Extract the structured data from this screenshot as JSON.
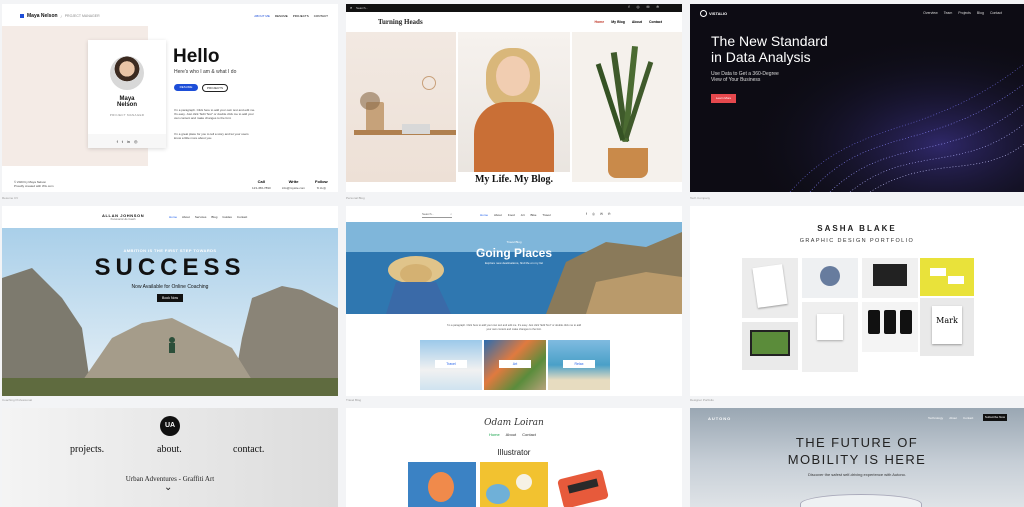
{
  "card1": {
    "brand": "Maya Nelson",
    "brand_sub": "PROJECT MANAGER",
    "nav": [
      "ABOUT ME",
      "RESUME",
      "PROJECTS",
      "CONTACT"
    ],
    "card_name": "Maya\nNelson",
    "card_role": "PROJECT MANAGER",
    "hello": "Hello",
    "tagline": "Here's who I am & what I do",
    "btn_resume": "RESUME",
    "btn_projects": "PROJECTS",
    "para1": "I'm a paragraph. Click here to add your own text and edit me. It's easy. Just click \"Edit Text\" or double click me to add your own content and make changes to the font.",
    "para2": "I'm a great place for you to tell a story and let your users know a little more about you.",
    "footer_copy": "© 2023 by Maya Nelson",
    "footer_copy2": "Proudly created with Wix.com",
    "call_label": "Call",
    "call_value": "123-456-7890",
    "write_label": "Write",
    "write_value": "info@mysite.com",
    "follow_label": "Follow",
    "caption": "Resume CV",
    "colors": {
      "accent": "#1d4ed8",
      "panel": "#f4ebe6"
    }
  },
  "card2": {
    "search": "Search...",
    "title": "Turning Heads",
    "nav": [
      "Home",
      "My Blog",
      "About",
      "Contact"
    ],
    "banner": "My Life. My Blog.",
    "caption": "Personal Blog"
  },
  "card3": {
    "logo": "VISTALIO",
    "nav": [
      "Overview",
      "Team",
      "Projects",
      "Blog",
      "Contact"
    ],
    "headline": "The New Standard\nin Data Analysis",
    "sub": "Use Data to Get a 360-Degree\nView of Your Business",
    "cta": "Learn More",
    "caption": "Tech Company",
    "colors": {
      "cta": "#e5484d"
    }
  },
  "card4": {
    "brand": "ALLAN JOHNSON",
    "brand_sub": "Personal & Life Coach",
    "nav": [
      "Home",
      "About",
      "Services",
      "Blog",
      "Guides",
      "Contact"
    ],
    "kicker": "AMBITION IS THE FIRST STEP TOWARDS",
    "headline": "SUCCESS",
    "sub": "Now Available for Online Coaching",
    "cta": "Book Now",
    "caption": "Coaching Professional"
  },
  "card5": {
    "search": "Search...",
    "nav": [
      "Home",
      "About",
      "Food",
      "Art",
      "Bike",
      "Travel"
    ],
    "kicker": "Travel Blog",
    "headline": "Going Places",
    "sub": "Explore new destinations, find life on my list",
    "para": "I'm a paragraph. Click here to add your own text and edit me. It's easy. Just click \"Edit Text\" or double click me to add your own content and make changes to the font.",
    "thumbs": [
      "Travel",
      "Art",
      "Relax"
    ],
    "caption": "Travel Blog"
  },
  "card6": {
    "name": "SASHA BLAKE",
    "subtitle": "GRAPHIC DESIGN PORTFOLIO",
    "caption": "Designer Portfolio"
  },
  "card7": {
    "logo": "UA",
    "links": [
      "projects.",
      "about.",
      "contact."
    ],
    "title": "Urban Adventures - Graffiti Art",
    "chevron": "⌄"
  },
  "card8": {
    "logo": "Odam Loiran",
    "nav": [
      "Home",
      "About",
      "Contact"
    ],
    "section": "Illustrator"
  },
  "card9": {
    "logo": "AUTONO",
    "nav": [
      "Technology",
      "About",
      "Contact"
    ],
    "cta": "Subscribe Now",
    "headline": "THE FUTURE OF\nMOBILITY IS HERE",
    "sub": "Discover the safest self-driving experience with Autono."
  }
}
